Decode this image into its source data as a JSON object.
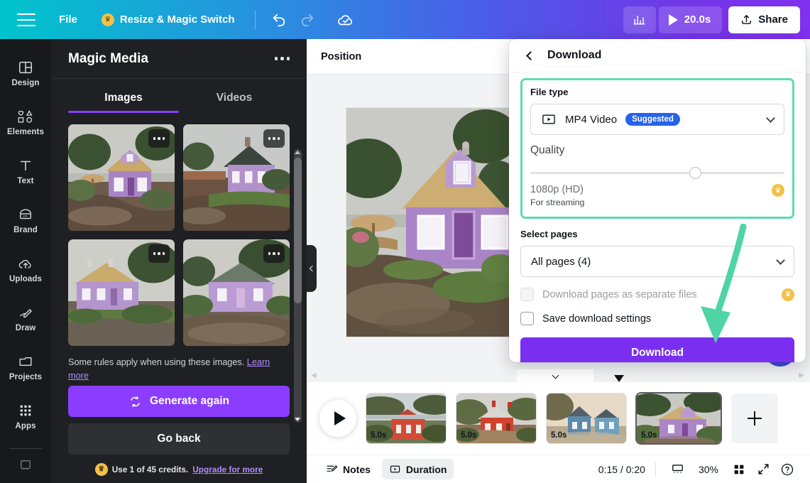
{
  "topbar": {
    "menu_icon": "hamburger-icon",
    "file_label": "File",
    "resize_label": "Resize & Magic Switch",
    "resize_badge_icon": "crown-icon",
    "undo_icon": "undo-icon",
    "redo_icon": "redo-icon",
    "cloud_icon": "cloud-check-icon",
    "stats_icon": "bar-chart-icon",
    "play_icon": "play-icon",
    "duration_label": "20.0s",
    "share_icon": "share-upload-icon",
    "share_label": "Share"
  },
  "sidebar": {
    "items": [
      {
        "label": "Design",
        "icon": "layout-icon"
      },
      {
        "label": "Elements",
        "icon": "shapes-icon"
      },
      {
        "label": "Text",
        "icon": "text-t-icon"
      },
      {
        "label": "Brand",
        "icon": "brand-tag-icon"
      },
      {
        "label": "Uploads",
        "icon": "upload-cloud-icon"
      },
      {
        "label": "Draw",
        "icon": "pen-icon"
      },
      {
        "label": "Projects",
        "icon": "folder-icon"
      },
      {
        "label": "Apps",
        "icon": "grid-dots-icon"
      }
    ]
  },
  "magic_media": {
    "title": "Magic Media",
    "more_icon": "more-options-icon",
    "tabs": [
      {
        "label": "Images",
        "active": true
      },
      {
        "label": "Videos",
        "active": false
      }
    ],
    "results": [
      {
        "name": "generated-image-1",
        "alt": "purple thatched cottage by water"
      },
      {
        "name": "generated-image-2",
        "alt": "purple cottage with dark roof"
      },
      {
        "name": "generated-image-3",
        "alt": "lilac cottage with thatched roof"
      },
      {
        "name": "generated-image-4",
        "alt": "lilac cottage with green roof"
      }
    ],
    "rules_text": "Some rules apply when using these images.",
    "rules_link": "Learn more",
    "generate_label": "Generate again",
    "generate_icon": "refresh-icon",
    "go_back_label": "Go back",
    "credits_icon": "crown-icon",
    "credits_text": "Use 1 of 45 credits.",
    "credits_link": "Upgrade for more"
  },
  "stage": {
    "position_label": "Position",
    "collapse_icon": "chevron-left-icon"
  },
  "download": {
    "back_icon": "chevron-left-icon",
    "title": "Download",
    "file_type_label": "File type",
    "file_type_value": "MP4 Video",
    "file_type_icon": "video-file-icon",
    "file_type_badge": "Suggested",
    "file_type_chevron": "chevron-down-icon",
    "quality_label": "Quality",
    "quality_slider_percent": 65,
    "quality_value": "1080p (HD)",
    "quality_sub": "For streaming",
    "quality_crown_icon": "crown-icon",
    "select_pages_label": "Select pages",
    "select_pages_value": "All pages (4)",
    "select_pages_chevron": "chevron-down-icon",
    "separate_files_label": "Download pages as separate files",
    "separate_files_checked": false,
    "separate_files_crown_icon": "crown-icon",
    "save_settings_label": "Save download settings",
    "save_settings_checked": false,
    "download_button_label": "Download",
    "highlight_color": "#5ddcae",
    "accent_color": "#7a2ff0",
    "badge_color": "#2563eb"
  },
  "timeline": {
    "expand_icon": "chevron-down-icon",
    "play_icon": "play-icon",
    "clips": [
      {
        "duration": "5.0s",
        "selected": false,
        "alt": "red cottage by shore"
      },
      {
        "duration": "5.0s",
        "selected": false,
        "alt": "red cottage on path"
      },
      {
        "duration": "5.0s",
        "selected": false,
        "alt": "blue cottages at dusk"
      },
      {
        "duration": "5.0s",
        "selected": true,
        "alt": "purple cottage"
      }
    ],
    "add_page_icon": "plus-icon"
  },
  "bottombar": {
    "notes_icon": "notes-icon",
    "notes_label": "Notes",
    "duration_icon": "duration-icon",
    "duration_label": "Duration",
    "time_display": "0:15 / 0:20",
    "present_icon": "presenter-view-icon",
    "zoom_level": "30%",
    "grid_icon": "grid-view-icon",
    "fullscreen_icon": "expand-icon",
    "help_icon": "help-circle-icon"
  }
}
